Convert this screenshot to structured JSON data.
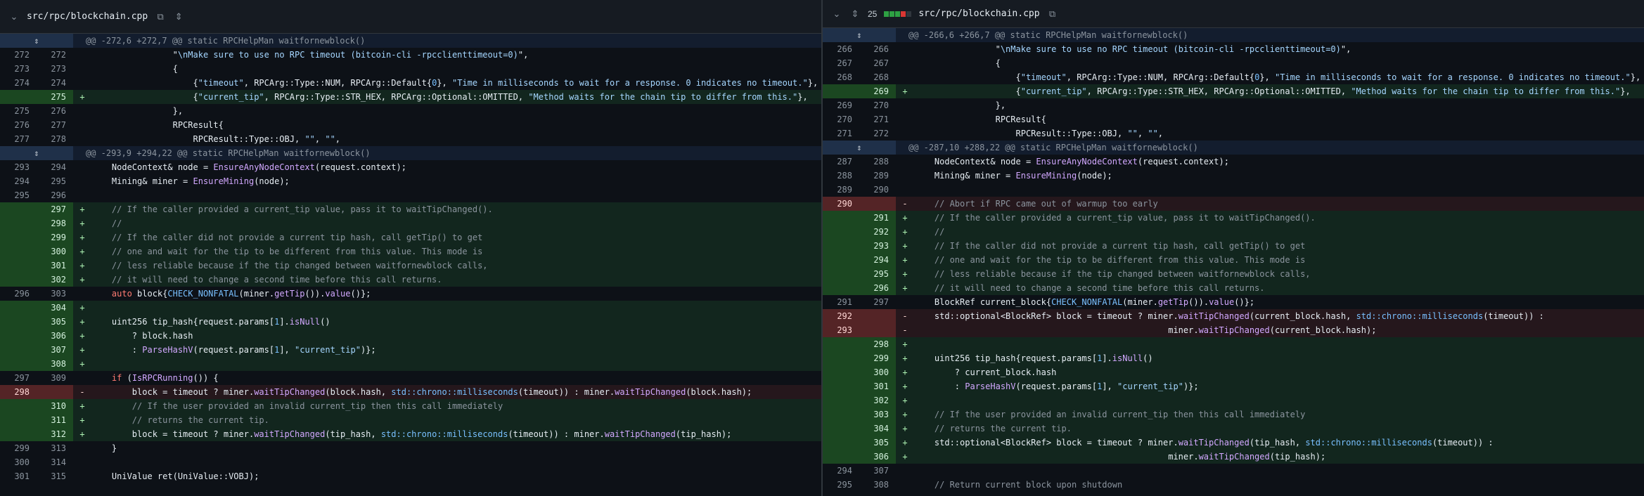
{
  "left": {
    "file_name": "src/rpc/blockchain.cpp",
    "rows": [
      {
        "t": "hunk",
        "text": "@@ -272,6 +272,7 @@ static RPCHelpMan waitfornewblock()"
      },
      {
        "t": "ctx",
        "o": "272",
        "n": "272",
        "segs": [
          [
            "",
            "                \""
          ],
          [
            "s",
            "\\nMake sure to use no RPC timeout (bitcoin-cli -rpcclienttimeout=0)"
          ],
          [
            "",
            "\","
          ]
        ]
      },
      {
        "t": "ctx",
        "o": "273",
        "n": "273",
        "segs": [
          [
            "",
            "                {"
          ]
        ]
      },
      {
        "t": "ctx",
        "o": "274",
        "n": "274",
        "segs": [
          [
            "",
            "                    {"
          ],
          [
            "s",
            "\"timeout\""
          ],
          [
            "",
            ", RPCArg::Type::NUM, RPCArg::Default{"
          ],
          [
            "n",
            "0"
          ],
          [
            "",
            "}, "
          ],
          [
            "s",
            "\"Time in milliseconds to wait for a response. 0 indicates no timeout.\""
          ],
          [
            "",
            "},"
          ]
        ]
      },
      {
        "t": "add",
        "o": "",
        "n": "275",
        "segs": [
          [
            "",
            "                    {"
          ],
          [
            "s",
            "\"current_tip\""
          ],
          [
            "",
            ", RPCArg::Type::STR_HEX, RPCArg::Optional::OMITTED, "
          ],
          [
            "s",
            "\"Method waits for the chain tip to differ from this.\""
          ],
          [
            "",
            "},"
          ]
        ]
      },
      {
        "t": "ctx",
        "o": "275",
        "n": "276",
        "segs": [
          [
            "",
            "                },"
          ]
        ]
      },
      {
        "t": "ctx",
        "o": "276",
        "n": "277",
        "segs": [
          [
            "",
            "                RPCResult{"
          ]
        ]
      },
      {
        "t": "ctx",
        "o": "277",
        "n": "278",
        "segs": [
          [
            "",
            "                    RPCResult::Type::OBJ, "
          ],
          [
            "s",
            "\"\""
          ],
          [
            "",
            ", "
          ],
          [
            "s",
            "\"\""
          ],
          [
            "",
            ","
          ]
        ]
      },
      {
        "t": "hunk",
        "text": "@@ -293,9 +294,22 @@ static RPCHelpMan waitfornewblock()"
      },
      {
        "t": "ctx",
        "o": "293",
        "n": "294",
        "segs": [
          [
            "",
            "    NodeContext& node = "
          ],
          [
            "f",
            "EnsureAnyNodeContext"
          ],
          [
            "",
            "(request.context);"
          ]
        ]
      },
      {
        "t": "ctx",
        "o": "294",
        "n": "295",
        "segs": [
          [
            "",
            "    Mining& miner = "
          ],
          [
            "f",
            "EnsureMining"
          ],
          [
            "",
            "(node);"
          ]
        ]
      },
      {
        "t": "ctx",
        "o": "295",
        "n": "296",
        "segs": [
          [
            "",
            ""
          ]
        ]
      },
      {
        "t": "add",
        "o": "",
        "n": "297",
        "segs": [
          [
            "c",
            "    // If the caller provided a current_tip value, pass it to waitTipChanged()."
          ]
        ]
      },
      {
        "t": "add",
        "o": "",
        "n": "298",
        "segs": [
          [
            "c",
            "    //"
          ]
        ]
      },
      {
        "t": "add",
        "o": "",
        "n": "299",
        "segs": [
          [
            "c",
            "    // If the caller did not provide a current tip hash, call getTip() to get"
          ]
        ]
      },
      {
        "t": "add",
        "o": "",
        "n": "300",
        "segs": [
          [
            "c",
            "    // one and wait for the tip to be different from this value. This mode is"
          ]
        ]
      },
      {
        "t": "add",
        "o": "",
        "n": "301",
        "segs": [
          [
            "c",
            "    // less reliable because if the tip changed between waitfornewblock calls,"
          ]
        ]
      },
      {
        "t": "add",
        "o": "",
        "n": "302",
        "segs": [
          [
            "c",
            "    // it will need to change a second time before this call returns."
          ]
        ]
      },
      {
        "t": "ctx",
        "o": "296",
        "n": "303",
        "segs": [
          [
            "k",
            "    auto"
          ],
          [
            "",
            " block{"
          ],
          [
            "n",
            "CHECK_NONFATAL"
          ],
          [
            "",
            "(miner."
          ],
          [
            "f",
            "getTip"
          ],
          [
            "",
            "())."
          ],
          [
            "f",
            "value"
          ],
          [
            "",
            "()};"
          ]
        ]
      },
      {
        "t": "add",
        "o": "",
        "n": "304",
        "segs": [
          [
            "",
            ""
          ]
        ]
      },
      {
        "t": "add",
        "o": "",
        "n": "305",
        "segs": [
          [
            "",
            "    uint256 tip_hash{request.params["
          ],
          [
            "n",
            "1"
          ],
          [
            "",
            "]."
          ],
          [
            "f",
            "isNull"
          ],
          [
            "",
            "()"
          ]
        ]
      },
      {
        "t": "add",
        "o": "",
        "n": "306",
        "segs": [
          [
            "",
            "        ? block.hash"
          ]
        ]
      },
      {
        "t": "add",
        "o": "",
        "n": "307",
        "segs": [
          [
            "",
            "        : "
          ],
          [
            "f",
            "ParseHashV"
          ],
          [
            "",
            "(request.params["
          ],
          [
            "n",
            "1"
          ],
          [
            "",
            "], "
          ],
          [
            "s",
            "\"current_tip\""
          ],
          [
            "",
            ")};"
          ]
        ]
      },
      {
        "t": "add",
        "o": "",
        "n": "308",
        "segs": [
          [
            "",
            ""
          ]
        ]
      },
      {
        "t": "ctx",
        "o": "297",
        "n": "309",
        "segs": [
          [
            "k",
            "    if"
          ],
          [
            "",
            " ("
          ],
          [
            "f",
            "IsRPCRunning"
          ],
          [
            "",
            "()) {"
          ]
        ]
      },
      {
        "t": "del",
        "o": "298",
        "n": "",
        "segs": [
          [
            "",
            "        block = timeout ? miner."
          ],
          [
            "f",
            "waitTipChanged"
          ],
          [
            "",
            "(block.hash, "
          ],
          [
            "n",
            "std::chrono::milliseconds"
          ],
          [
            "",
            "(timeout)) : miner."
          ],
          [
            "f",
            "waitTipChanged"
          ],
          [
            "",
            "(block.hash);"
          ]
        ]
      },
      {
        "t": "add",
        "o": "",
        "n": "310",
        "segs": [
          [
            "c",
            "        // If the user provided an invalid current_tip then this call immediately"
          ]
        ]
      },
      {
        "t": "add",
        "o": "",
        "n": "311",
        "segs": [
          [
            "c",
            "        // returns the current tip."
          ]
        ]
      },
      {
        "t": "add",
        "o": "",
        "n": "312",
        "segs": [
          [
            "",
            "        block = timeout ? miner."
          ],
          [
            "f",
            "waitTipChanged"
          ],
          [
            "",
            "(tip_hash, "
          ],
          [
            "n",
            "std::chrono::milliseconds"
          ],
          [
            "",
            "(timeout)) : miner."
          ],
          [
            "f",
            "waitTipChanged"
          ],
          [
            "",
            "(tip_hash);"
          ]
        ]
      },
      {
        "t": "ctx",
        "o": "299",
        "n": "313",
        "segs": [
          [
            "",
            "    }"
          ]
        ]
      },
      {
        "t": "ctx",
        "o": "300",
        "n": "314",
        "segs": [
          [
            "",
            ""
          ]
        ]
      },
      {
        "t": "ctx",
        "o": "301",
        "n": "315",
        "segs": [
          [
            "",
            "    UniValue ret(UniValue::VOBJ);"
          ]
        ]
      }
    ]
  },
  "right": {
    "change_count": "25",
    "file_name": "src/rpc/blockchain.cpp",
    "bars": [
      "#2ea043",
      "#2ea043",
      "#2ea043",
      "#da3633",
      "#30363d"
    ],
    "rows": [
      {
        "t": "hunk",
        "text": "@@ -266,6 +266,7 @@ static RPCHelpMan waitfornewblock()"
      },
      {
        "t": "ctx",
        "o": "266",
        "n": "266",
        "segs": [
          [
            "",
            "                \""
          ],
          [
            "s",
            "\\nMake sure to use no RPC timeout (bitcoin-cli -rpcclienttimeout=0)"
          ],
          [
            "",
            "\","
          ]
        ]
      },
      {
        "t": "ctx",
        "o": "267",
        "n": "267",
        "segs": [
          [
            "",
            "                {"
          ]
        ]
      },
      {
        "t": "ctx",
        "o": "268",
        "n": "268",
        "segs": [
          [
            "",
            "                    {"
          ],
          [
            "s",
            "\"timeout\""
          ],
          [
            "",
            ", RPCArg::Type::NUM, RPCArg::Default{"
          ],
          [
            "n",
            "0"
          ],
          [
            "",
            "}, "
          ],
          [
            "s",
            "\"Time in milliseconds to wait for a response. 0 indicates no timeout.\""
          ],
          [
            "",
            "},"
          ]
        ]
      },
      {
        "t": "add",
        "o": "",
        "n": "269",
        "segs": [
          [
            "",
            "                    {"
          ],
          [
            "s",
            "\"current_tip\""
          ],
          [
            "",
            ", RPCArg::Type::STR_HEX, RPCArg::Optional::OMITTED, "
          ],
          [
            "s",
            "\"Method waits for the chain tip to differ from this.\""
          ],
          [
            "",
            "},"
          ]
        ]
      },
      {
        "t": "ctx",
        "o": "269",
        "n": "270",
        "segs": [
          [
            "",
            "                },"
          ]
        ]
      },
      {
        "t": "ctx",
        "o": "270",
        "n": "271",
        "segs": [
          [
            "",
            "                RPCResult{"
          ]
        ]
      },
      {
        "t": "ctx",
        "o": "271",
        "n": "272",
        "segs": [
          [
            "",
            "                    RPCResult::Type::OBJ, "
          ],
          [
            "s",
            "\"\""
          ],
          [
            "",
            ", "
          ],
          [
            "s",
            "\"\""
          ],
          [
            "",
            ","
          ]
        ]
      },
      {
        "t": "hunk",
        "text": "@@ -287,10 +288,22 @@ static RPCHelpMan waitfornewblock()"
      },
      {
        "t": "ctx",
        "o": "287",
        "n": "288",
        "segs": [
          [
            "",
            "    NodeContext& node = "
          ],
          [
            "f",
            "EnsureAnyNodeContext"
          ],
          [
            "",
            "(request.context);"
          ]
        ]
      },
      {
        "t": "ctx",
        "o": "288",
        "n": "289",
        "segs": [
          [
            "",
            "    Mining& miner = "
          ],
          [
            "f",
            "EnsureMining"
          ],
          [
            "",
            "(node);"
          ]
        ]
      },
      {
        "t": "ctx",
        "o": "289",
        "n": "290",
        "segs": [
          [
            "",
            ""
          ]
        ]
      },
      {
        "t": "del",
        "o": "290",
        "n": "",
        "segs": [
          [
            "c",
            "    // Abort if RPC came out of warmup too early"
          ]
        ]
      },
      {
        "t": "add",
        "o": "",
        "n": "291",
        "segs": [
          [
            "c",
            "    // If the caller provided a current_tip value, pass it to waitTipChanged()."
          ]
        ]
      },
      {
        "t": "add",
        "o": "",
        "n": "292",
        "segs": [
          [
            "c",
            "    //"
          ]
        ]
      },
      {
        "t": "add",
        "o": "",
        "n": "293",
        "segs": [
          [
            "c",
            "    // If the caller did not provide a current tip hash, call getTip() to get"
          ]
        ]
      },
      {
        "t": "add",
        "o": "",
        "n": "294",
        "segs": [
          [
            "c",
            "    // one and wait for the tip to be different from this value. This mode is"
          ]
        ]
      },
      {
        "t": "add",
        "o": "",
        "n": "295",
        "segs": [
          [
            "c",
            "    // less reliable because if the tip changed between waitfornewblock calls,"
          ]
        ]
      },
      {
        "t": "add",
        "o": "",
        "n": "296",
        "segs": [
          [
            "c",
            "    // it will need to change a second time before this call returns."
          ]
        ]
      },
      {
        "t": "ctx",
        "o": "291",
        "n": "297",
        "segs": [
          [
            "",
            "    BlockRef current_block{"
          ],
          [
            "n",
            "CHECK_NONFATAL"
          ],
          [
            "",
            "(miner."
          ],
          [
            "f",
            "getTip"
          ],
          [
            "",
            "())."
          ],
          [
            "f",
            "value"
          ],
          [
            "",
            "()};"
          ]
        ]
      },
      {
        "t": "del",
        "o": "292",
        "n": "",
        "segs": [
          [
            "",
            "    std::optional<BlockRef> block = timeout ? miner."
          ],
          [
            "f",
            "waitTipChanged"
          ],
          [
            "",
            "(current_block.hash, "
          ],
          [
            "n",
            "std::chrono::milliseconds"
          ],
          [
            "",
            "(timeout)) :"
          ]
        ]
      },
      {
        "t": "del",
        "o": "293",
        "n": "",
        "segs": [
          [
            "",
            "                                                  miner."
          ],
          [
            "f",
            "waitTipChanged"
          ],
          [
            "",
            "(current_block.hash);"
          ]
        ]
      },
      {
        "t": "add",
        "o": "",
        "n": "298",
        "segs": [
          [
            "",
            ""
          ]
        ]
      },
      {
        "t": "add",
        "o": "",
        "n": "299",
        "segs": [
          [
            "",
            "    uint256 tip_hash{request.params["
          ],
          [
            "n",
            "1"
          ],
          [
            "",
            "]."
          ],
          [
            "f",
            "isNull"
          ],
          [
            "",
            "()"
          ]
        ]
      },
      {
        "t": "add",
        "o": "",
        "n": "300",
        "segs": [
          [
            "",
            "        ? current_block.hash"
          ]
        ]
      },
      {
        "t": "add",
        "o": "",
        "n": "301",
        "segs": [
          [
            "",
            "        : "
          ],
          [
            "f",
            "ParseHashV"
          ],
          [
            "",
            "(request.params["
          ],
          [
            "n",
            "1"
          ],
          [
            "",
            "], "
          ],
          [
            "s",
            "\"current_tip\""
          ],
          [
            "",
            ")};"
          ]
        ]
      },
      {
        "t": "add",
        "o": "",
        "n": "302",
        "segs": [
          [
            "",
            ""
          ]
        ]
      },
      {
        "t": "add",
        "o": "",
        "n": "303",
        "segs": [
          [
            "c",
            "    // If the user provided an invalid current_tip then this call immediately"
          ]
        ]
      },
      {
        "t": "add",
        "o": "",
        "n": "304",
        "segs": [
          [
            "c",
            "    // returns the current tip."
          ]
        ]
      },
      {
        "t": "add",
        "o": "",
        "n": "305",
        "segs": [
          [
            "",
            "    std::optional<BlockRef> block = timeout ? miner."
          ],
          [
            "f",
            "waitTipChanged"
          ],
          [
            "",
            "(tip_hash, "
          ],
          [
            "n",
            "std::chrono::milliseconds"
          ],
          [
            "",
            "(timeout)) :"
          ]
        ]
      },
      {
        "t": "add",
        "o": "",
        "n": "306",
        "segs": [
          [
            "",
            "                                                  miner."
          ],
          [
            "f",
            "waitTipChanged"
          ],
          [
            "",
            "(tip_hash);"
          ]
        ]
      },
      {
        "t": "ctx",
        "o": "294",
        "n": "307",
        "segs": [
          [
            "",
            ""
          ]
        ]
      },
      {
        "t": "ctx",
        "o": "295",
        "n": "308",
        "segs": [
          [
            "c",
            "    // Return current block upon shutdown"
          ]
        ]
      }
    ]
  }
}
